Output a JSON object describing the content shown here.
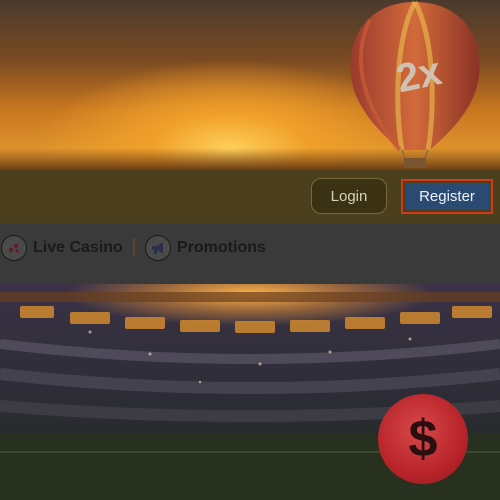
{
  "hero": {
    "badge_text": "2x"
  },
  "header": {
    "login_label": "Login",
    "register_label": "Register"
  },
  "nav": {
    "items": [
      {
        "label": "Live Casino",
        "icon": "dice-icon"
      },
      {
        "label": "Promotions",
        "icon": "megaphone-icon"
      }
    ]
  },
  "colors": {
    "header_bg": "#4b3f1d",
    "register_bg": "#2a4a72",
    "register_outline": "#d23a1e",
    "coin": "#b8242a"
  }
}
